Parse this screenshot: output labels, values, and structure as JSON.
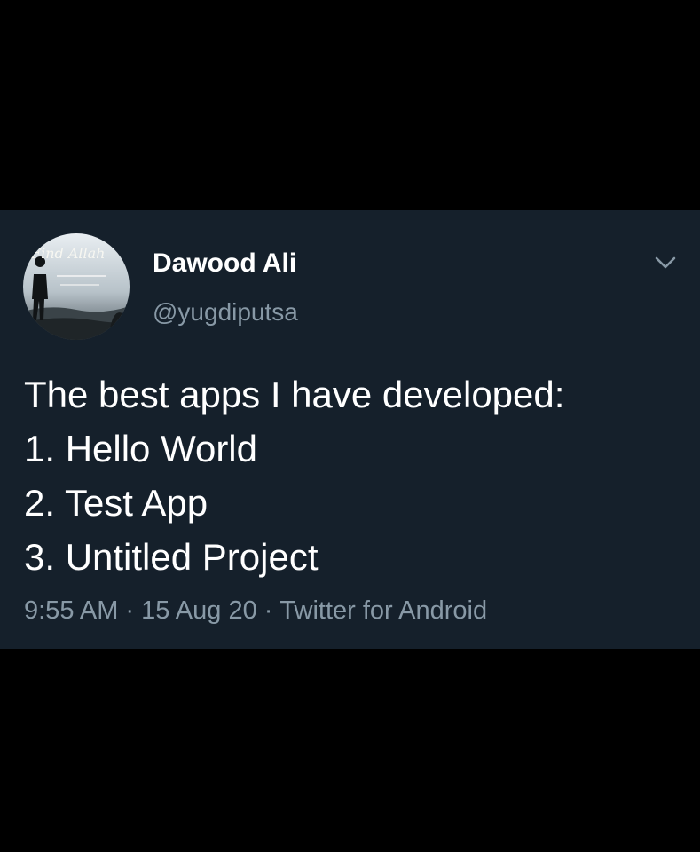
{
  "tweet": {
    "author": {
      "display_name": "Dawood Ali",
      "handle": "@yugdiputsa",
      "avatar_text": "Find Allah"
    },
    "body_lines": [
      "The best apps I have developed:",
      "1. Hello World",
      "2. Test App",
      "3. Untitled Project"
    ],
    "meta": {
      "time": "9:55 AM",
      "separator": "·",
      "date": "15 Aug 20",
      "source": "Twitter for Android"
    }
  },
  "colors": {
    "page_background": "#000000",
    "card_background": "#15202b",
    "primary_text": "#ffffff",
    "secondary_text": "#8899a6"
  },
  "icons": {
    "caret": "chevron-down-icon"
  }
}
